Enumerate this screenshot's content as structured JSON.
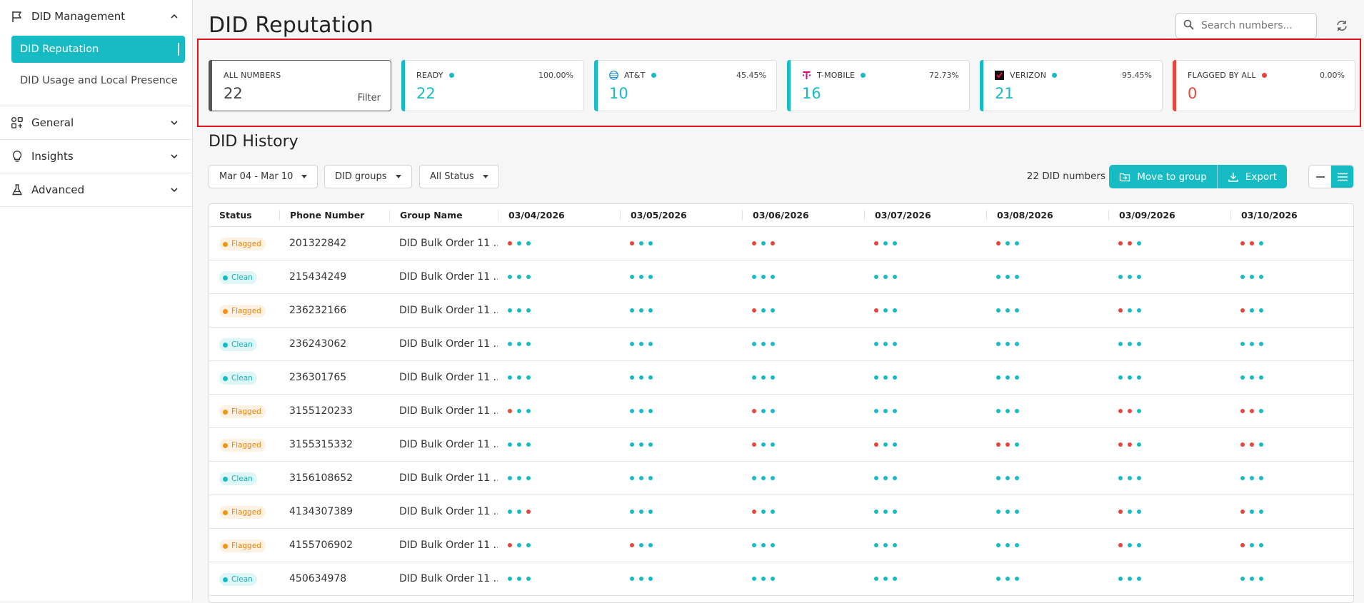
{
  "sidebar": {
    "sections": [
      {
        "label": "DID Management",
        "expanded": true,
        "icon": "flag-icon"
      },
      {
        "label": "General",
        "icon": "apps-icon"
      },
      {
        "label": "Insights",
        "icon": "bulb-icon"
      },
      {
        "label": "Advanced",
        "icon": "flask-icon"
      }
    ],
    "sub_items": [
      {
        "label": "DID Reputation",
        "active": true
      },
      {
        "label": "DID Usage and Local Presence",
        "active": false
      }
    ]
  },
  "header": {
    "title": "DID Reputation",
    "search_placeholder": "Search numbers..."
  },
  "stats": [
    {
      "label": "ALL NUMBERS",
      "value": "22",
      "pct": "",
      "action": "Filter",
      "color": "#555555",
      "dot": ""
    },
    {
      "label": "READY",
      "value": "22",
      "pct": "100.00%",
      "color": "#17bbc4",
      "dot": "#17bbc4"
    },
    {
      "label": "AT&T",
      "value": "10",
      "pct": "45.45%",
      "color": "#17bbc4",
      "dot": "#17bbc4",
      "icon": "att-icon"
    },
    {
      "label": "T-MOBILE",
      "value": "16",
      "pct": "72.73%",
      "color": "#17bbc4",
      "dot": "#17bbc4",
      "icon": "tmobile-icon"
    },
    {
      "label": "VERIZON",
      "value": "21",
      "pct": "95.45%",
      "color": "#17bbc4",
      "dot": "#17bbc4",
      "icon": "verizon-icon"
    },
    {
      "label": "FLAGGED BY ALL",
      "value": "0",
      "pct": "0.00%",
      "color": "#e8453c",
      "dot": "#e8453c"
    }
  ],
  "history": {
    "title": "DID History",
    "date_range": "Mar 04 - Mar 10",
    "groups_filter": "DID groups",
    "status_filter": "All Status",
    "count_text": "22 DID numbers",
    "move_label": "Move to group",
    "export_label": "Export"
  },
  "table": {
    "columns": [
      "Status",
      "Phone Number",
      "Group Name",
      "03/04/2026",
      "03/05/2026",
      "03/06/2026",
      "03/07/2026",
      "03/08/2026",
      "03/09/2026",
      "03/10/2026"
    ],
    "rows": [
      {
        "status": "Flagged",
        "phone": "201322842",
        "group": "DID Bulk Order 11 ...",
        "days": [
          "bgg",
          "bgg",
          "bgb",
          "bgg",
          "bgg",
          "bbg",
          "bbg"
        ]
      },
      {
        "status": "Clean",
        "phone": "215434249",
        "group": "DID Bulk Order 11 ...",
        "days": [
          "ggg",
          "ggg",
          "ggg",
          "ggg",
          "ggg",
          "ggg",
          "ggg"
        ]
      },
      {
        "status": "Flagged",
        "phone": "236232166",
        "group": "DID Bulk Order 11 ...",
        "days": [
          "ggg",
          "ggg",
          "bgg",
          "bgg",
          "ggg",
          "bgg",
          "bgg"
        ]
      },
      {
        "status": "Clean",
        "phone": "236243062",
        "group": "DID Bulk Order 11 ...",
        "days": [
          "ggg",
          "ggg",
          "ggg",
          "ggg",
          "ggg",
          "ggg",
          "ggg"
        ]
      },
      {
        "status": "Clean",
        "phone": "236301765",
        "group": "DID Bulk Order 11 ...",
        "days": [
          "ggg",
          "ggg",
          "ggg",
          "ggg",
          "ggg",
          "ggg",
          "ggg"
        ]
      },
      {
        "status": "Flagged",
        "phone": "3155120233",
        "group": "DID Bulk Order 11 ...",
        "days": [
          "bgg",
          "ggg",
          "bgg",
          "ggg",
          "ggg",
          "bbg",
          "bbg"
        ]
      },
      {
        "status": "Flagged",
        "phone": "3155315332",
        "group": "DID Bulk Order 11 ...",
        "days": [
          "ggg",
          "ggg",
          "bgg",
          "bgg",
          "bbg",
          "bbg",
          "bbg"
        ]
      },
      {
        "status": "Clean",
        "phone": "3156108652",
        "group": "DID Bulk Order 11 ...",
        "days": [
          "ggg",
          "ggg",
          "ggg",
          "ggg",
          "ggg",
          "ggg",
          "ggg"
        ]
      },
      {
        "status": "Flagged",
        "phone": "4134307389",
        "group": "DID Bulk Order 11 ...",
        "days": [
          "ggb",
          "ggg",
          "bgg",
          "ggg",
          "ggg",
          "bgg",
          "bgg"
        ]
      },
      {
        "status": "Flagged",
        "phone": "4155706902",
        "group": "DID Bulk Order 11 ...",
        "days": [
          "bgg",
          "bgg",
          "ggg",
          "ggg",
          "ggg",
          "bgg",
          "bgg"
        ]
      },
      {
        "status": "Clean",
        "phone": "450634978",
        "group": "DID Bulk Order 11 ...",
        "days": [
          "ggg",
          "ggg",
          "ggg",
          "ggg",
          "ggg",
          "ggg",
          "ggg"
        ]
      }
    ]
  }
}
